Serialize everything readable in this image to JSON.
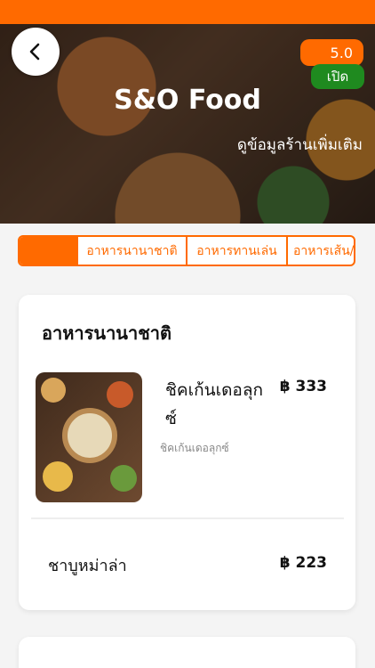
{
  "header": {
    "shop_name": "S&O Food",
    "rating": "5.0",
    "status": "เปิด",
    "more_info": "ดูข้อมูลร้านเพิ่มเติม"
  },
  "tabs": [
    "",
    "อาหารนานาชาติ",
    "อาหารทานเล่น",
    "อาหารเส้น/"
  ],
  "section": {
    "title": "อาหารนานาชาติ",
    "items": [
      {
        "name": "ชิคเก้นเดอลุกซ์",
        "price": "฿ 333",
        "description": "ชิคเก้นเดอลุกซ์"
      },
      {
        "name": "ชาบูหม่าล่า",
        "price": "฿ 223"
      }
    ]
  },
  "colors": {
    "accent": "#ff6a00",
    "open": "#1f8a1f"
  }
}
